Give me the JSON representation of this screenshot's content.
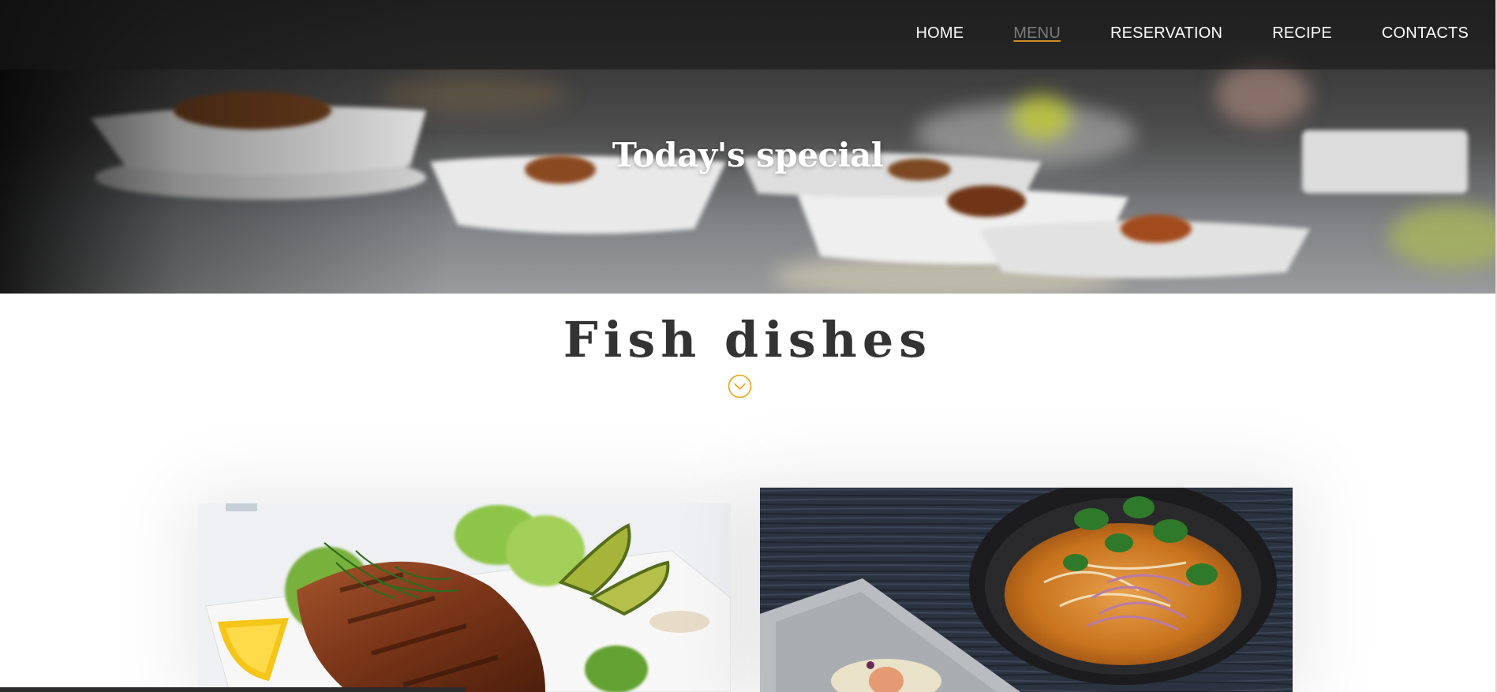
{
  "nav": {
    "items": [
      {
        "label": "HOME",
        "active": false
      },
      {
        "label": "MENU",
        "active": true
      },
      {
        "label": "RESERVATION",
        "active": false
      },
      {
        "label": "RECIPE",
        "active": false
      },
      {
        "label": "CONTACTS",
        "active": false
      }
    ]
  },
  "hero": {
    "title": "Today's special"
  },
  "section": {
    "title": "Fish dishes",
    "scroll_icon": "chevron-down-circle-icon"
  },
  "cards": [
    {
      "name": "grilled-salmon-image"
    },
    {
      "name": "curry-noodle-bowl-image"
    }
  ],
  "colors": {
    "accent": "#e8a317",
    "heading": "#333333",
    "nav_text": "#ffffff",
    "nav_active": "#7b7b7b"
  }
}
